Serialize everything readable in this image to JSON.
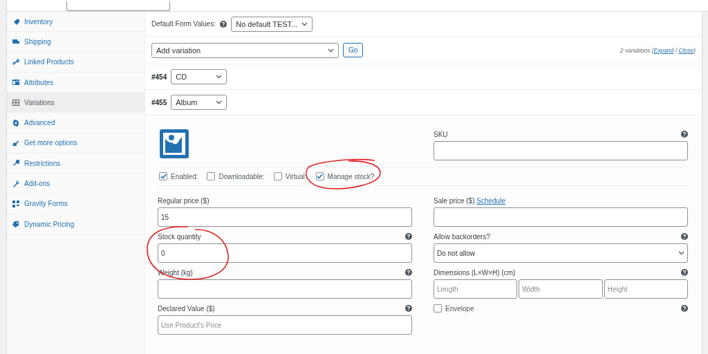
{
  "sidebar": {
    "items": [
      {
        "label": "Inventory",
        "selected": false
      },
      {
        "label": "Shipping",
        "selected": false
      },
      {
        "label": "Linked Products",
        "selected": false
      },
      {
        "label": "Attributes",
        "selected": false
      },
      {
        "label": "Variations",
        "selected": true
      },
      {
        "label": "Advanced",
        "selected": false
      },
      {
        "label": "Get more options",
        "selected": false
      },
      {
        "label": "Restrictions",
        "selected": false
      },
      {
        "label": "Add-ons",
        "selected": false
      },
      {
        "label": "Gravity Forms",
        "selected": false
      },
      {
        "label": "Dynamic Pricing",
        "selected": false
      }
    ]
  },
  "default_form_values": {
    "label": "Default Form Values:",
    "value": "No default TEST..."
  },
  "toolbar": {
    "action": "Add variation",
    "button": "Go",
    "count_prefix": "2 variations (",
    "expand": "Expand",
    "separator": " / ",
    "close": "Close",
    "count_suffix": ")"
  },
  "variations": [
    {
      "id": "#454",
      "value": "CD"
    },
    {
      "id": "#455",
      "value": "Album"
    }
  ],
  "variation_details": {
    "sku_label": "SKU",
    "options": [
      {
        "label": "Enabled:",
        "checked": true
      },
      {
        "label": "Downloadable:",
        "checked": false
      },
      {
        "label": "Virtual:",
        "checked": false
      },
      {
        "label": "Manage stock?",
        "checked": true
      }
    ],
    "fields": [
      {
        "kind": "text",
        "label": "Regular price ($)",
        "value": "15",
        "help": false
      },
      {
        "kind": "text",
        "label": "Sale price ($)",
        "link": "Schedule",
        "help": false
      },
      {
        "kind": "text",
        "label": "Stock quantity",
        "value": "0",
        "help": true
      },
      {
        "kind": "select",
        "label": "Allow backorders?",
        "value": "Do not allow",
        "help": true
      },
      {
        "kind": "text",
        "label": "Weight (kg)",
        "help": true
      },
      {
        "kind": "dimensions",
        "label": "Dimensions (L×W×H) (cm)",
        "placeholders": [
          "Length",
          "Width",
          "Height"
        ],
        "help": true
      },
      {
        "kind": "text",
        "label": "Declared Value ($)",
        "placeholder": "Use Product's Price",
        "help": true
      },
      {
        "kind": "checkbox",
        "label": "Envelope",
        "checked": false,
        "help": true
      }
    ]
  }
}
